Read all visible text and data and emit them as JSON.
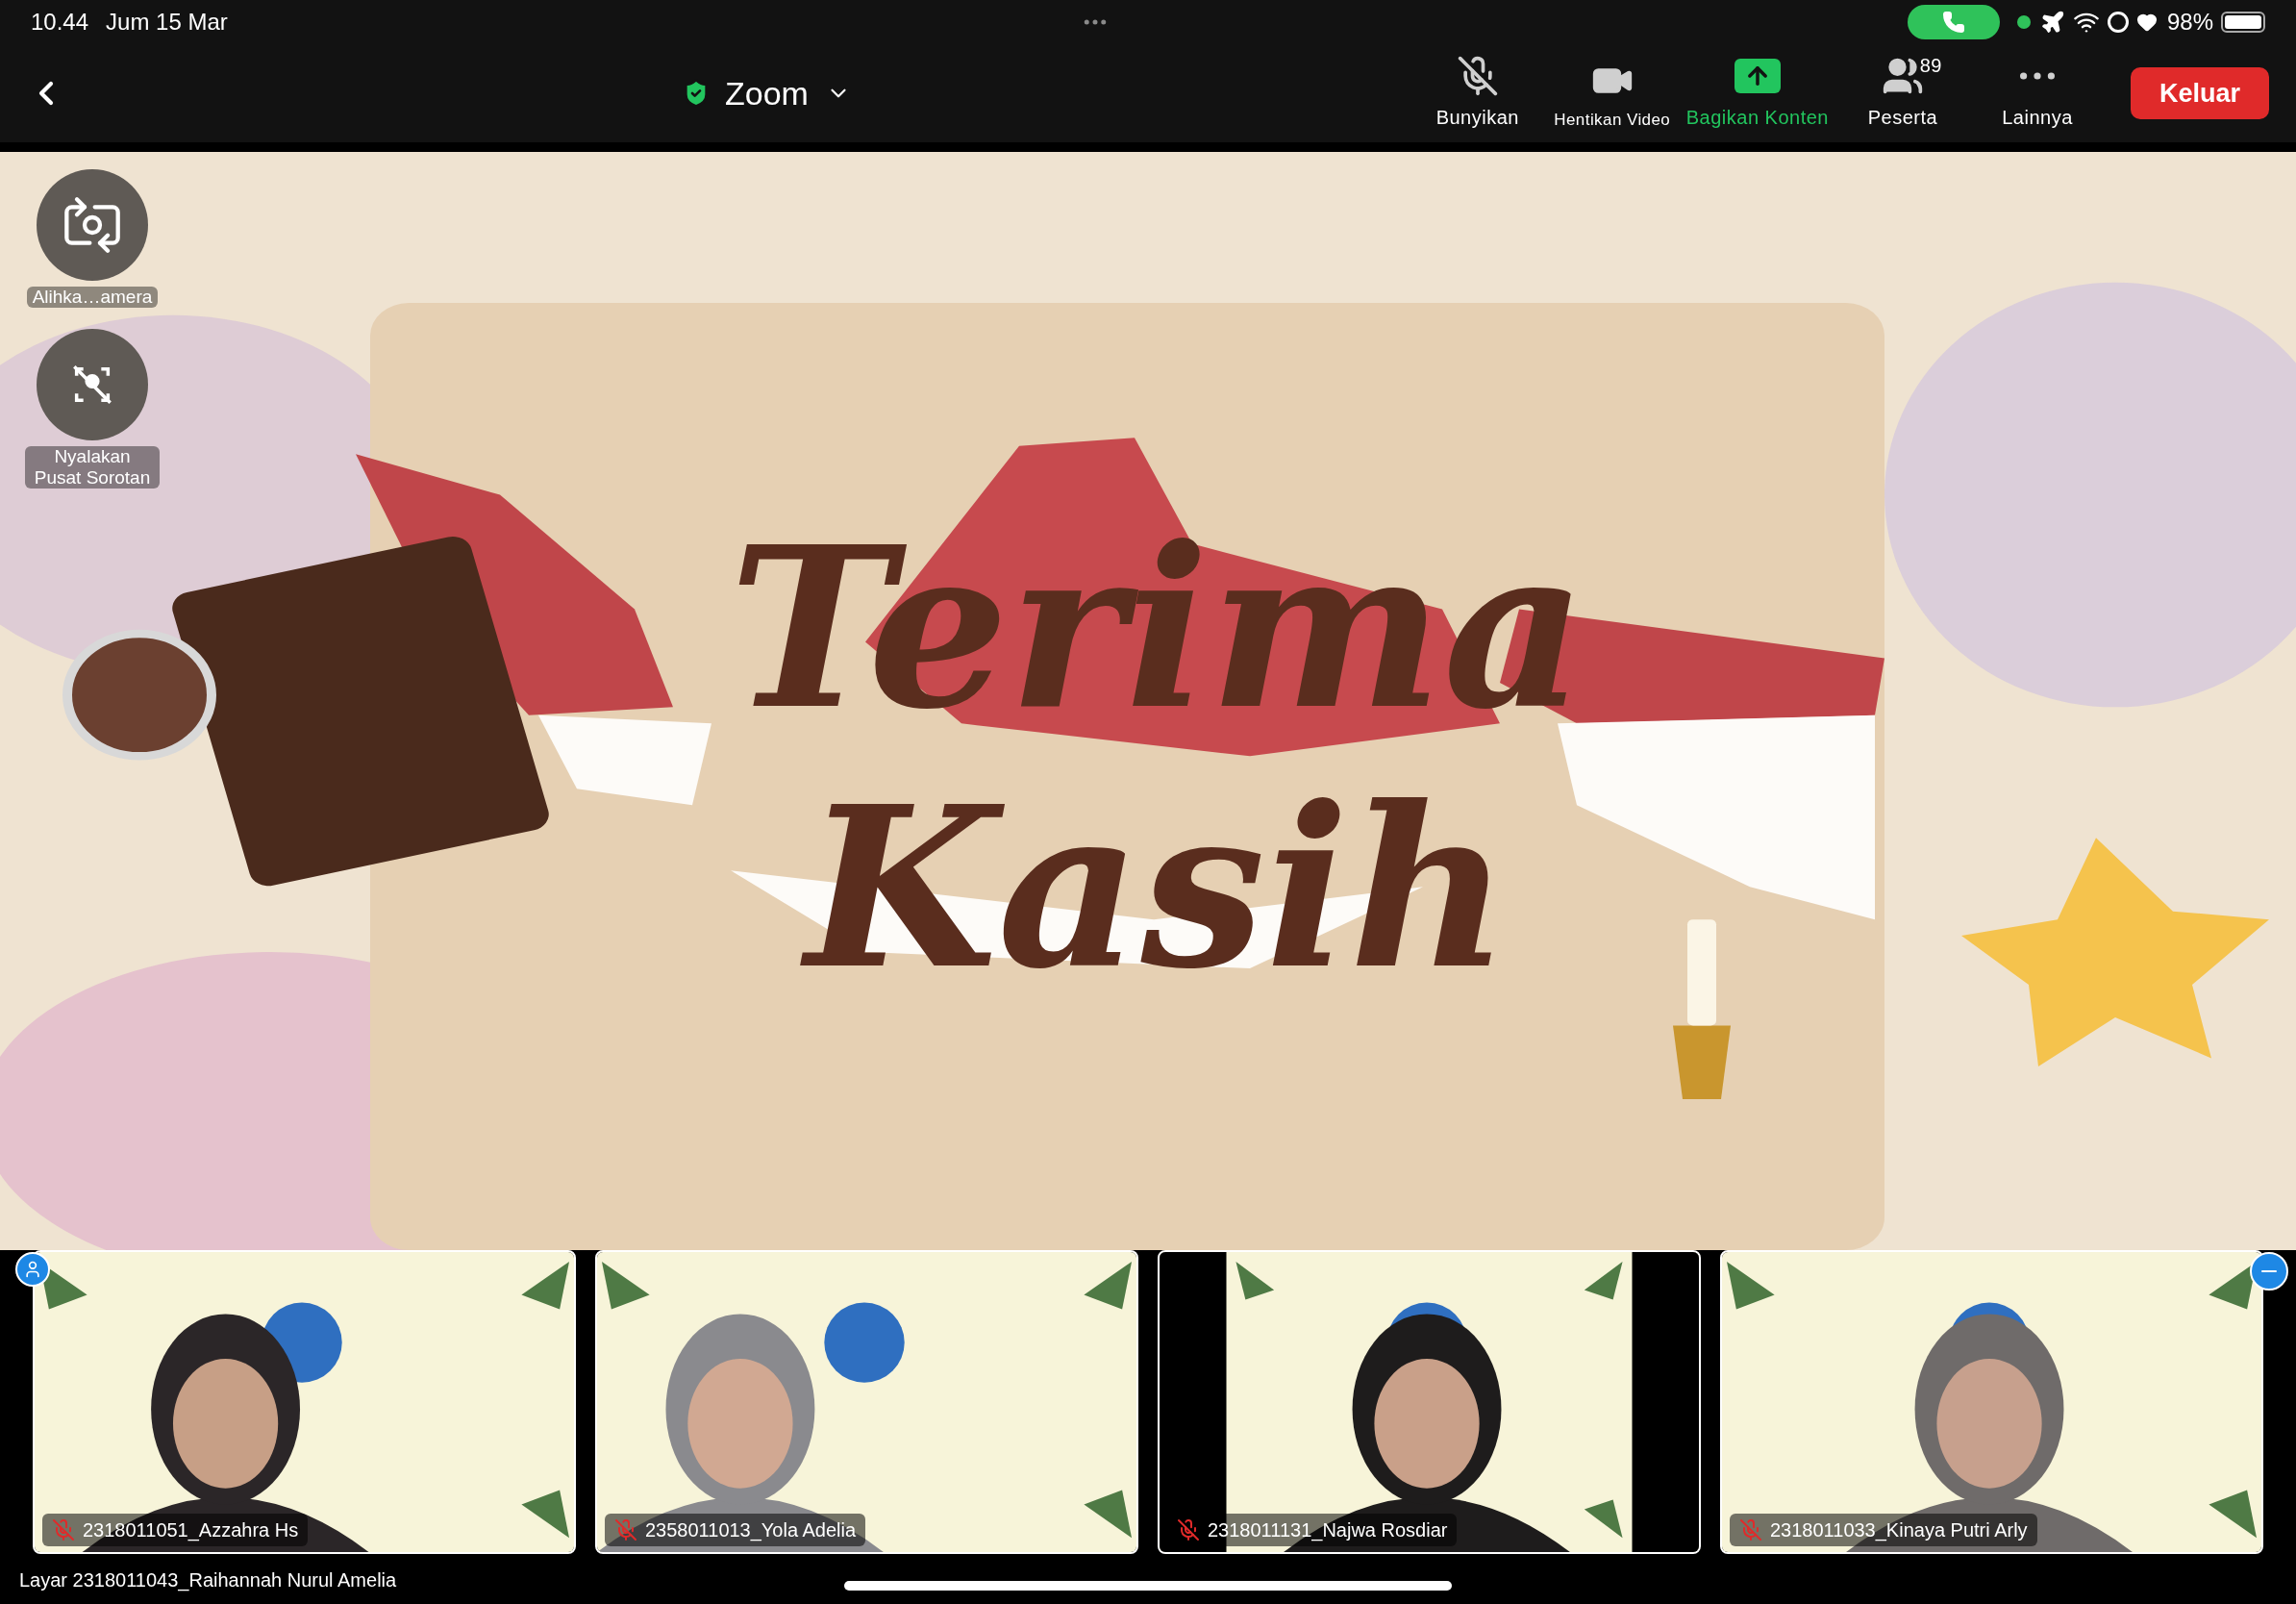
{
  "status_bar": {
    "time": "10.44",
    "date": "Jum 15 Mar",
    "battery": "98%"
  },
  "toolbar": {
    "title": "Zoom",
    "actions": [
      {
        "kind": "mute",
        "label": "Bunyikan",
        "active": false
      },
      {
        "kind": "video",
        "label": "Hentikan Video",
        "active": false
      },
      {
        "kind": "share",
        "label": "Bagikan Konten",
        "active": true
      },
      {
        "kind": "participants",
        "label": "Peserta",
        "count": "89",
        "active": false
      },
      {
        "kind": "more",
        "label": "Lainnya",
        "active": false
      }
    ],
    "leave_button": "Keluar"
  },
  "floating_controls": [
    {
      "kind": "switch-camera",
      "label": "Alihka…amera"
    },
    {
      "kind": "spotlight",
      "label": "Nyalakan Pusat Sorotan"
    }
  ],
  "slide": {
    "title_lines": [
      "Terima",
      "Kasih"
    ]
  },
  "participants": [
    {
      "name": "2318011051_Azzahra Hs",
      "muted": true
    },
    {
      "name": "2358011013_Yola Adelia",
      "muted": true
    },
    {
      "name": "2318011131_Najwa Rosdiar",
      "muted": true
    },
    {
      "name": "2318011033_Kinaya Putri Arly",
      "muted": true
    }
  ],
  "share_caption": "Layar 2318011043_Raihannah Nurul Amelia"
}
